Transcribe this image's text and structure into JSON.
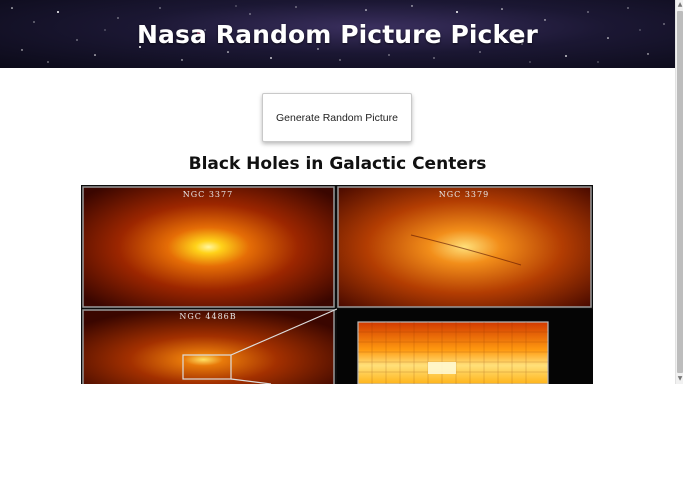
{
  "header": {
    "title": "Nasa Random Picture Picker"
  },
  "controls": {
    "generate_label": "Generate Random Picture"
  },
  "picture": {
    "title": "Black Holes in Galactic Centers",
    "panel_labels": [
      "NGC 3377",
      "NGC 3379",
      "NGC 4486B"
    ]
  },
  "colors": {
    "header_bg": "#1b1733",
    "title_text": "#111111",
    "button_border": "#c9c9c9"
  },
  "icons": {
    "scroll_up": "▲",
    "scroll_down": "▼"
  }
}
